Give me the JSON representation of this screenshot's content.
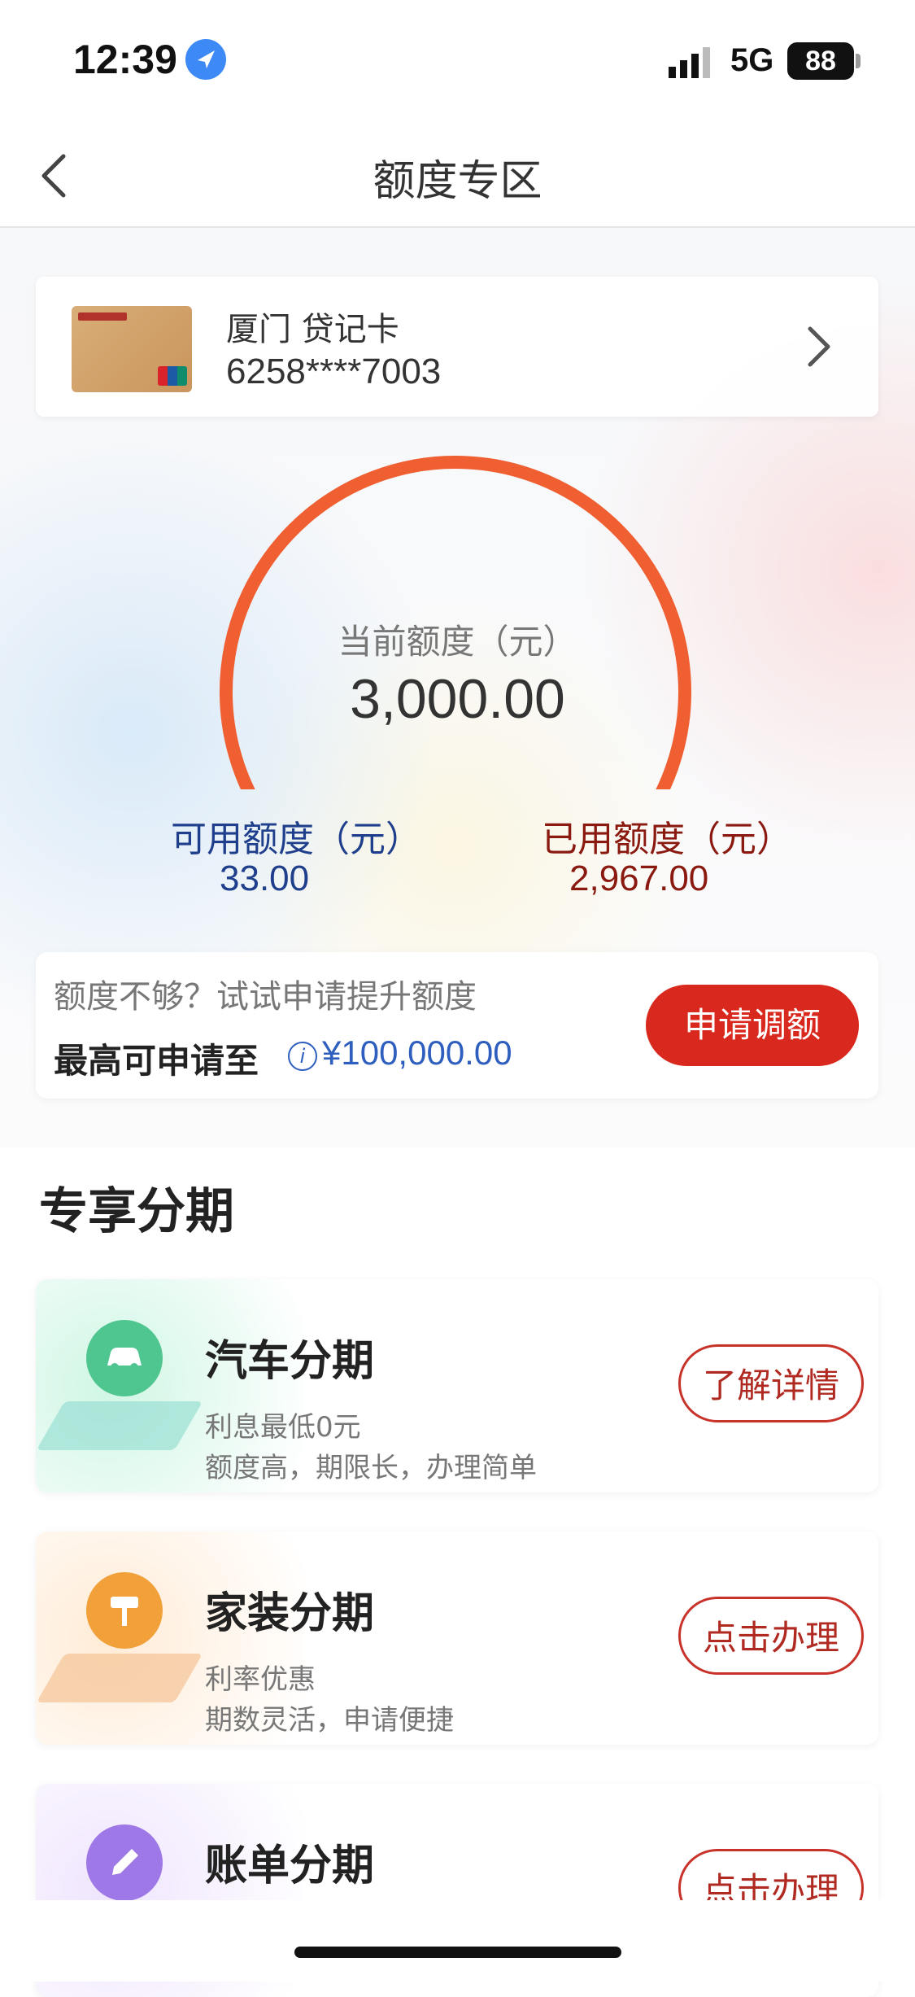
{
  "status": {
    "time": "12:39",
    "network": "5G",
    "battery": "88"
  },
  "nav": {
    "title": "额度专区"
  },
  "card": {
    "name": "厦门 贷记卡",
    "number": "6258****7003"
  },
  "quota": {
    "current_label": "当前额度（元）",
    "current_value": "3,000.00",
    "available_label": "可用额度（元）",
    "available_value": "33.00",
    "used_label": "已用额度（元）",
    "used_value": "2,967.00",
    "used_fraction": 0.989
  },
  "raise": {
    "hint": "额度不够？试试申请提升额度",
    "max_label": "最高可申请至",
    "max_amount": "¥100,000.00",
    "button": "申请调额"
  },
  "section": {
    "title": "专享分期"
  },
  "installments": [
    {
      "title": "汽车分期",
      "desc1": "利息最低0元",
      "desc2": "额度高，期限长，办理简单",
      "button": "了解详情",
      "icon": "car-icon",
      "color": "#4fc68f"
    },
    {
      "title": "家装分期",
      "desc1": "利率优惠",
      "desc2": "期数灵活，申请便捷",
      "button": "点击办理",
      "icon": "paint-roller-icon",
      "color": "#f2a13a"
    },
    {
      "title": "账单分期",
      "button": "点击办理",
      "icon": "pencil-icon",
      "color": "#9f78e8"
    }
  ],
  "colors": {
    "accent": "#d9281d",
    "gauge": "#ef5f31",
    "available": "#1f3f8c",
    "used": "#8a1a10"
  }
}
